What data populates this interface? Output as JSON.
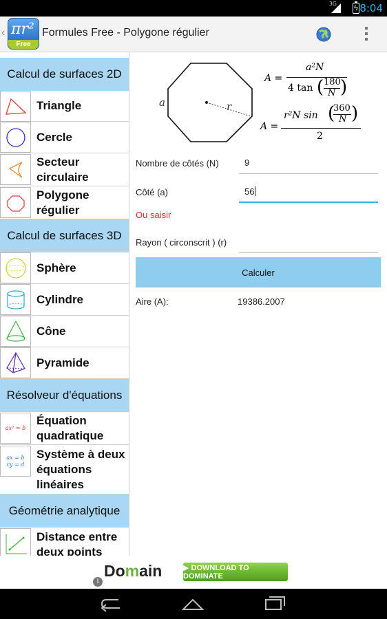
{
  "status_bar": {
    "network": "3G",
    "time": "8:04"
  },
  "action_bar": {
    "title": "Formules Free - Polygone régulier",
    "app_icon_free": "Free",
    "icons": [
      "globe-icon",
      "overflow-menu-icon"
    ]
  },
  "sidebar": {
    "sections": [
      {
        "header": "Calcul de surfaces 2D",
        "items": [
          "Triangle",
          "Cercle",
          "Secteur circulaire",
          "Polygone régulier"
        ]
      },
      {
        "header": "Calcul de surfaces 3D",
        "items": [
          "Sphère",
          "Cylindre",
          "Cône",
          "Pyramide"
        ]
      },
      {
        "header": "Résolveur d'équations",
        "items": [
          "Équation quadratique",
          "Système à deux équations linéaires"
        ]
      },
      {
        "header": "Géométrie analytique",
        "items": [
          "Distance entre deux points"
        ]
      }
    ],
    "icon_texts": {
      "quadratic": "ax² = b",
      "system_line1": "ax = b",
      "system_line2": "cy = d"
    },
    "accent_color": "#a9d6f2"
  },
  "formula": {
    "side_label": "a",
    "radius_label": "r",
    "f1_lhs": "A =",
    "f1_num": "a²N",
    "f1_den": "4 tan",
    "f1_inner_num": "180",
    "f1_inner_den": "N",
    "f2_lhs": "A =",
    "f2_num": "r²N sin",
    "f2_inner_num": "360",
    "f2_inner_den": "N",
    "f2_den": "2"
  },
  "form": {
    "sides_label": "Nombre de côtés (N)",
    "sides_value": "9",
    "side_label": "Côté (a)",
    "side_value": "56",
    "or_enter": "Ou saisir",
    "radius_label": "Rayon ( circonscrit ) (r)",
    "radius_value": "",
    "calculate_button": "Calculer",
    "area_label": "Aire (A):",
    "area_value": "19386.2007",
    "button_color": "#8fcdee",
    "error_color": "#e02a2a"
  },
  "ad": {
    "logo_prefix": "Do",
    "logo_house": "m",
    "logo_suffix": "ain",
    "cta": "▶ DOWNLOAD TO DOMINATE",
    "info": "i"
  }
}
